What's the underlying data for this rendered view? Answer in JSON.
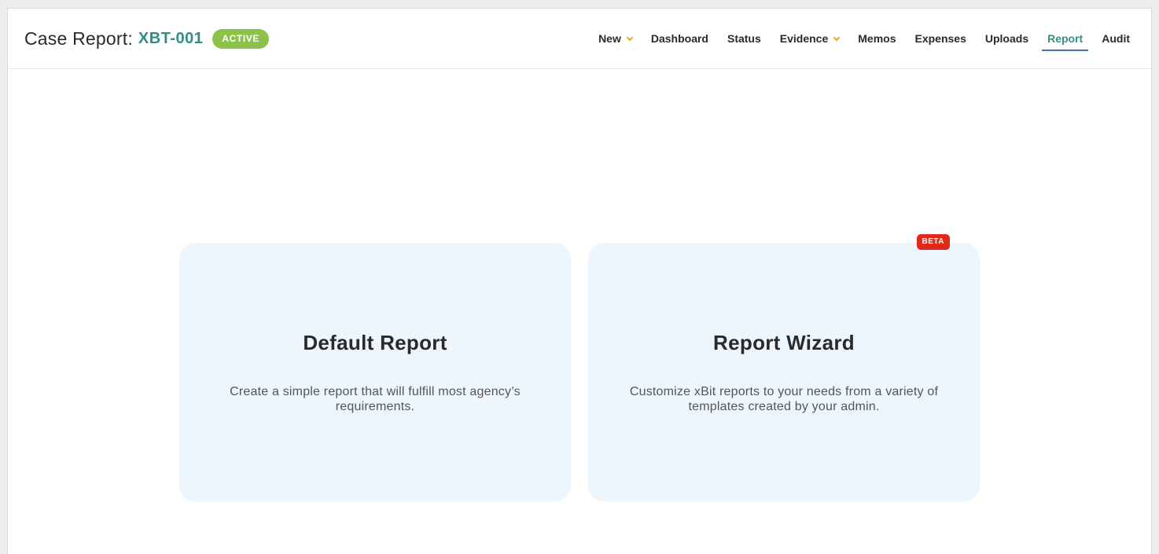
{
  "header": {
    "title": "Case Report:",
    "case_id": "XBT-001",
    "status": "ACTIVE"
  },
  "nav": {
    "items": [
      {
        "label": "New",
        "has_dropdown": true
      },
      {
        "label": "Dashboard"
      },
      {
        "label": "Status"
      },
      {
        "label": "Evidence",
        "has_dropdown": true
      },
      {
        "label": "Memos"
      },
      {
        "label": "Expenses"
      },
      {
        "label": "Uploads"
      },
      {
        "label": "Report",
        "active": true
      },
      {
        "label": "Audit"
      }
    ]
  },
  "cards": [
    {
      "title": "Default Report",
      "description": "Create a simple report that will fulfill most agency’s requirements."
    },
    {
      "title": "Report Wizard",
      "description": "Customize xBit reports to your needs from a variety of templates created by your admin.",
      "badge": "BETA"
    }
  ],
  "colors": {
    "accent": "#2f8f83",
    "status_badge": "#8bc34a",
    "beta_badge": "#e0281b",
    "card_bg": "#eef6fd",
    "dropdown_chevron": "#f0a020"
  }
}
